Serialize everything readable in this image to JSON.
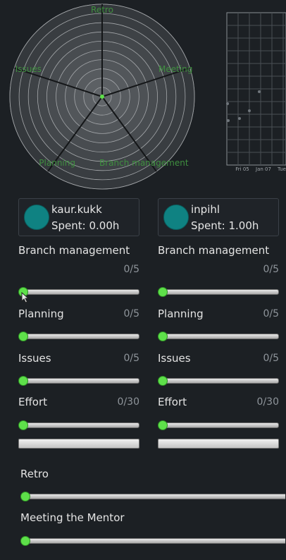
{
  "radar": {
    "axes": [
      "Retro",
      "Meeting",
      "Branch management",
      "Planning",
      "Issues"
    ],
    "ring_count": 10,
    "center_color": "#5ee04a",
    "label_color": "#3f8f3f"
  },
  "timeline": {
    "tick_labels": [
      "Fri 05",
      "Jan 07",
      "Tue"
    ]
  },
  "users": [
    {
      "name": "kaur.kukk",
      "spent": "Spent: 0.00h",
      "avatar_color": "#0f8282",
      "scores": [
        {
          "label": "Branch management",
          "count": "0/5",
          "value": 0
        },
        {
          "label": "Planning",
          "count": "0/5",
          "value": 0
        },
        {
          "label": "Issues",
          "count": "0/5",
          "value": 0
        },
        {
          "label": "Effort",
          "count": "0/30",
          "value": 0
        }
      ]
    },
    {
      "name": "inpihl",
      "spent": "Spent: 1.00h",
      "avatar_color": "#0f8282",
      "scores": [
        {
          "label": "Branch management",
          "count": "0/5",
          "value": 0
        },
        {
          "label": "Planning",
          "count": "0/5",
          "value": 0
        },
        {
          "label": "Issues",
          "count": "0/5",
          "value": 0
        },
        {
          "label": "Effort",
          "count": "0/30",
          "value": 0
        }
      ]
    }
  ],
  "shared_sliders": [
    {
      "label": "Retro",
      "value": 0
    },
    {
      "label": "Meeting the Mentor",
      "value": 0
    }
  ],
  "colors": {
    "background": "#1c2024",
    "accent": "#5ee04a",
    "avatar": "#0f8282"
  }
}
